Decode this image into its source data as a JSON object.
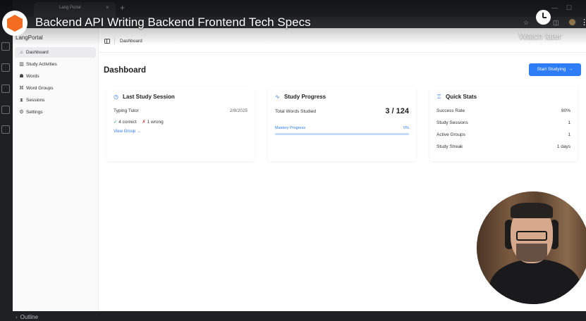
{
  "overlay": {
    "video_title": "Backend API Writing Backend Frontend Tech Specs",
    "watch_later": "Watch later"
  },
  "browser": {
    "tab_title": "Lang Portal",
    "new_tab": "+",
    "close_tab": "×"
  },
  "vscode": {
    "outline_label": "Outline"
  },
  "sidebar": {
    "brand": "LangPortal",
    "items": [
      {
        "label": "Dashboard",
        "icon": "home-icon",
        "active": true
      },
      {
        "label": "Study Activities",
        "icon": "book-icon",
        "active": false
      },
      {
        "label": "Words",
        "icon": "users-icon",
        "active": false
      },
      {
        "label": "Word Groups",
        "icon": "grid-icon",
        "active": false
      },
      {
        "label": "Sessions",
        "icon": "hourglass-icon",
        "active": false
      },
      {
        "label": "Settings",
        "icon": "gear-icon",
        "active": false
      }
    ]
  },
  "header": {
    "breadcrumb": "Dashboard"
  },
  "page": {
    "title": "Dashboard",
    "start_button": "Start Studying"
  },
  "last_session": {
    "heading": "Last Study Session",
    "activity": "Typing Tutor",
    "date": "2/8/2025",
    "correct": "4 correct",
    "wrong": "1 wrong",
    "link": "View Group"
  },
  "progress": {
    "heading": "Study Progress",
    "label": "Total Words Studied",
    "value": "3 / 124",
    "mastery_label": "Mastery Progress",
    "mastery_value": "0%",
    "mastery_fraction": 0
  },
  "quick_stats": {
    "heading": "Quick Stats",
    "rows": [
      {
        "label": "Success Rate",
        "value": "80%"
      },
      {
        "label": "Study Sessions",
        "value": "1"
      },
      {
        "label": "Active Groups",
        "value": "1"
      },
      {
        "label": "Study Streak",
        "value": "1 days"
      }
    ]
  },
  "colors": {
    "accent": "#2e7cf6",
    "correct": "#20a35a",
    "wrong": "#e03030"
  }
}
